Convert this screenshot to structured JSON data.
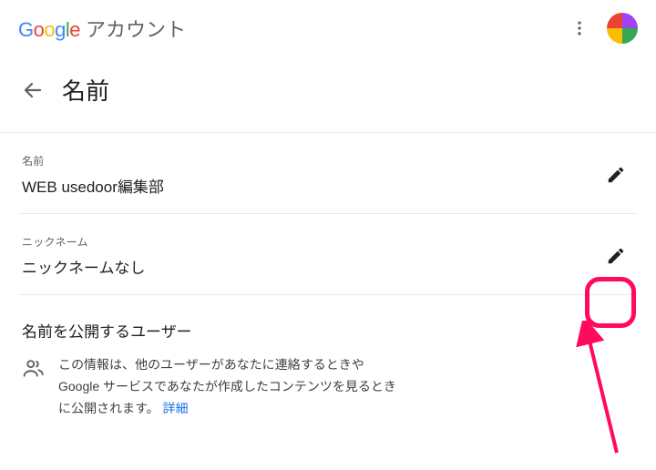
{
  "header": {
    "brand_suffix": "アカウント"
  },
  "page": {
    "title": "名前"
  },
  "fields": {
    "name": {
      "label": "名前",
      "value": "WEB usedoor編集部"
    },
    "nickname": {
      "label": "ニックネーム",
      "value": "ニックネームなし"
    }
  },
  "visibility": {
    "heading": "名前を公開するユーザー",
    "body": "この情報は、他のユーザーがあなたに連絡するときや Google サービスであなたが作成したコンテンツを見るときに公開されます。 ",
    "link": "詳細"
  }
}
